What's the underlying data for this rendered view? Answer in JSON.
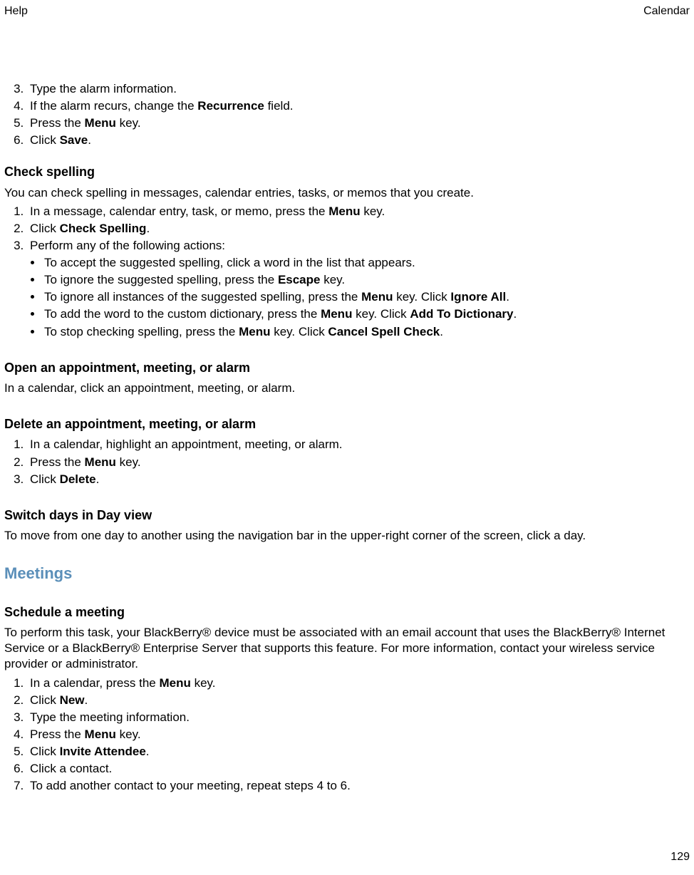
{
  "header": {
    "left": "Help",
    "right": "Calendar"
  },
  "footer": {
    "page_number": "129"
  },
  "section_top": {
    "steps": [
      {
        "n": "3.",
        "text": "Type the alarm information."
      },
      {
        "n": "4.",
        "pre": "If the alarm recurs, change the ",
        "bold": "Recurrence",
        "post": " field."
      },
      {
        "n": "5.",
        "pre": "Press the ",
        "bold": "Menu",
        "post": " key."
      },
      {
        "n": "6.",
        "pre": "Click ",
        "bold": "Save",
        "post": "."
      }
    ]
  },
  "check_spelling": {
    "heading": "Check spelling",
    "intro": "You can check spelling in messages, calendar entries, tasks, or memos that you create.",
    "steps": [
      {
        "n": "1.",
        "pre": "In a message, calendar entry, task, or memo, press the ",
        "bold": "Menu",
        "post": " key."
      },
      {
        "n": "2.",
        "pre": "Click ",
        "bold": "Check Spelling",
        "post": "."
      },
      {
        "n": "3.",
        "text": "Perform any of the following actions:"
      }
    ],
    "bullets": [
      {
        "text": "To accept the suggested spelling, click a word in the list that appears."
      },
      {
        "pre": "To ignore the suggested spelling, press the ",
        "bold": "Escape",
        "post": " key."
      },
      {
        "pre": "To ignore all instances of the suggested spelling, press the ",
        "bold": "Menu",
        "mid": " key. Click ",
        "bold2": "Ignore All",
        "post": "."
      },
      {
        "pre": "To add the word to the custom dictionary, press the ",
        "bold": "Menu",
        "mid": " key. Click ",
        "bold2": "Add To Dictionary",
        "post": "."
      },
      {
        "pre": "To stop checking spelling, press the ",
        "bold": "Menu",
        "mid": " key. Click ",
        "bold2": "Cancel Spell Check",
        "post": "."
      }
    ]
  },
  "open_section": {
    "heading": "Open an appointment, meeting, or alarm",
    "body": "In a calendar, click an appointment, meeting, or alarm."
  },
  "delete_section": {
    "heading": "Delete an appointment, meeting, or alarm",
    "steps": [
      {
        "n": "1.",
        "text": "In a calendar, highlight an appointment, meeting, or alarm."
      },
      {
        "n": "2.",
        "pre": "Press the ",
        "bold": "Menu",
        "post": " key."
      },
      {
        "n": "3.",
        "pre": "Click ",
        "bold": "Delete",
        "post": "."
      }
    ]
  },
  "switch_section": {
    "heading": "Switch days in Day view",
    "body": "To move from one day to another using the navigation bar in the upper-right corner of the screen, click a day."
  },
  "meetings_heading": "Meetings",
  "schedule_section": {
    "heading": "Schedule a meeting",
    "body": "To perform this task, your BlackBerry® device must be associated with an email account that uses the BlackBerry® Internet Service or a BlackBerry® Enterprise Server that supports this feature. For more information, contact your wireless service provider or administrator.",
    "steps": [
      {
        "n": "1.",
        "pre": "In a calendar, press the ",
        "bold": "Menu",
        "post": " key."
      },
      {
        "n": "2.",
        "pre": "Click ",
        "bold": "New",
        "post": "."
      },
      {
        "n": "3.",
        "text": "Type the meeting information."
      },
      {
        "n": "4.",
        "pre": "Press the ",
        "bold": "Menu",
        "post": " key."
      },
      {
        "n": "5.",
        "pre": "Click ",
        "bold": "Invite Attendee",
        "post": "."
      },
      {
        "n": "6.",
        "text": "Click a contact."
      },
      {
        "n": "7.",
        "text": "To add another contact to your meeting, repeat steps 4 to 6."
      }
    ]
  }
}
